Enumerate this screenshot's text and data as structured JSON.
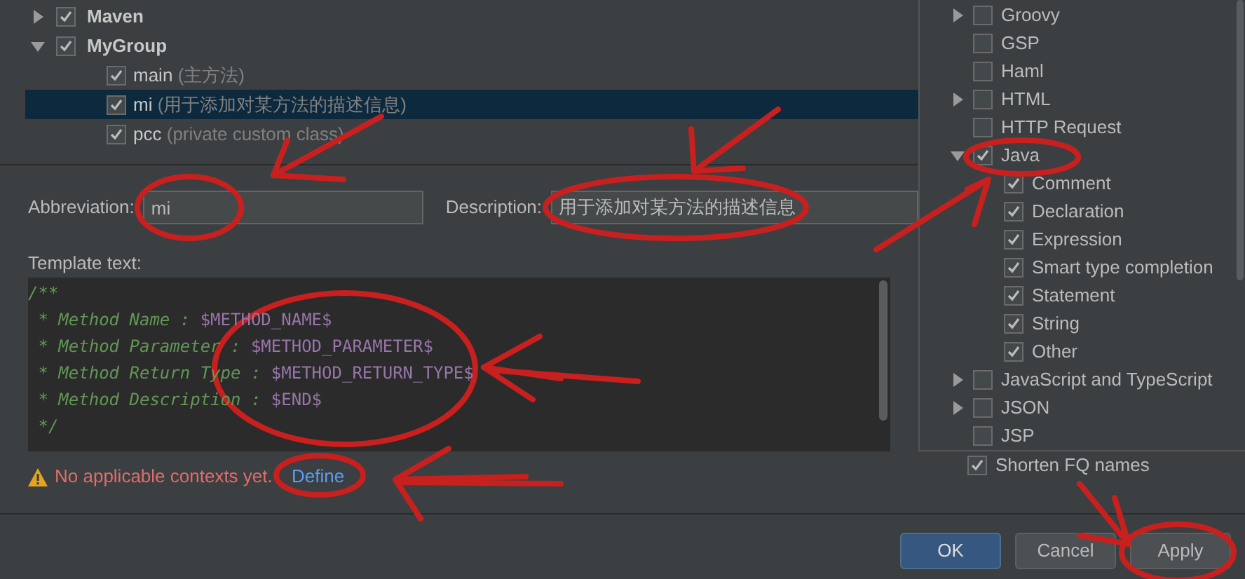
{
  "template_tree": [
    {
      "label": "Maven",
      "checked": true,
      "expanded": false
    },
    {
      "label": "MyGroup",
      "checked": true,
      "expanded": true,
      "children": [
        {
          "name": "main",
          "description": "(主方法)",
          "checked": true,
          "selected": false
        },
        {
          "name": "mi",
          "description": "(用于添加对某方法的描述信息)",
          "checked": true,
          "selected": true
        },
        {
          "name": "pcc",
          "description": "(private custom class)",
          "checked": true,
          "selected": false
        }
      ]
    }
  ],
  "abbreviation": {
    "label": "Abbreviation:",
    "value": "mi"
  },
  "description": {
    "label": "Description:",
    "value": "用于添加对某方法的描述信息"
  },
  "template_text": {
    "label": "Template text:",
    "lines": [
      [
        {
          "kind": "comment",
          "text": "/**"
        }
      ],
      [
        {
          "kind": "comment",
          "text": " * Method Name : "
        },
        {
          "kind": "variable",
          "text": "$METHOD_NAME$"
        }
      ],
      [
        {
          "kind": "comment",
          "text": " * Method Parameter : "
        },
        {
          "kind": "variable",
          "text": "$METHOD_PARAMETER$"
        }
      ],
      [
        {
          "kind": "comment",
          "text": " * Method Return Type : "
        },
        {
          "kind": "variable",
          "text": "$METHOD_RETURN_TYPE$"
        }
      ],
      [
        {
          "kind": "comment",
          "text": " * Method Description : "
        },
        {
          "kind": "variable",
          "text": "$END$"
        }
      ],
      [
        {
          "kind": "comment",
          "text": " */"
        }
      ]
    ]
  },
  "warning": {
    "text": "No applicable contexts yet.",
    "link": "Define"
  },
  "background_option": {
    "label": "Shorten FQ names",
    "checked": true
  },
  "context_popup": {
    "items": [
      {
        "label": "Groovy",
        "checked": false,
        "expanded": false
      },
      {
        "label": "GSP",
        "checked": false
      },
      {
        "label": "Haml",
        "checked": false
      },
      {
        "label": "HTML",
        "checked": false,
        "expanded": false
      },
      {
        "label": "HTTP Request",
        "checked": false
      },
      {
        "label": "Java",
        "checked": true,
        "expanded": true,
        "children": [
          {
            "label": "Comment",
            "checked": true
          },
          {
            "label": "Declaration",
            "checked": true
          },
          {
            "label": "Expression",
            "checked": true
          },
          {
            "label": "Smart type completion",
            "checked": true
          },
          {
            "label": "Statement",
            "checked": true
          },
          {
            "label": "String",
            "checked": true
          },
          {
            "label": "Other",
            "checked": true
          }
        ]
      },
      {
        "label": "JavaScript and TypeScript",
        "checked": false,
        "expanded": false
      },
      {
        "label": "JSON",
        "checked": false,
        "expanded": false
      },
      {
        "label": "JSP",
        "checked": false
      }
    ]
  },
  "buttons": [
    {
      "label": "OK",
      "kind": "primary"
    },
    {
      "label": "Cancel",
      "kind": "normal"
    },
    {
      "label": "Apply",
      "kind": "normal"
    }
  ]
}
